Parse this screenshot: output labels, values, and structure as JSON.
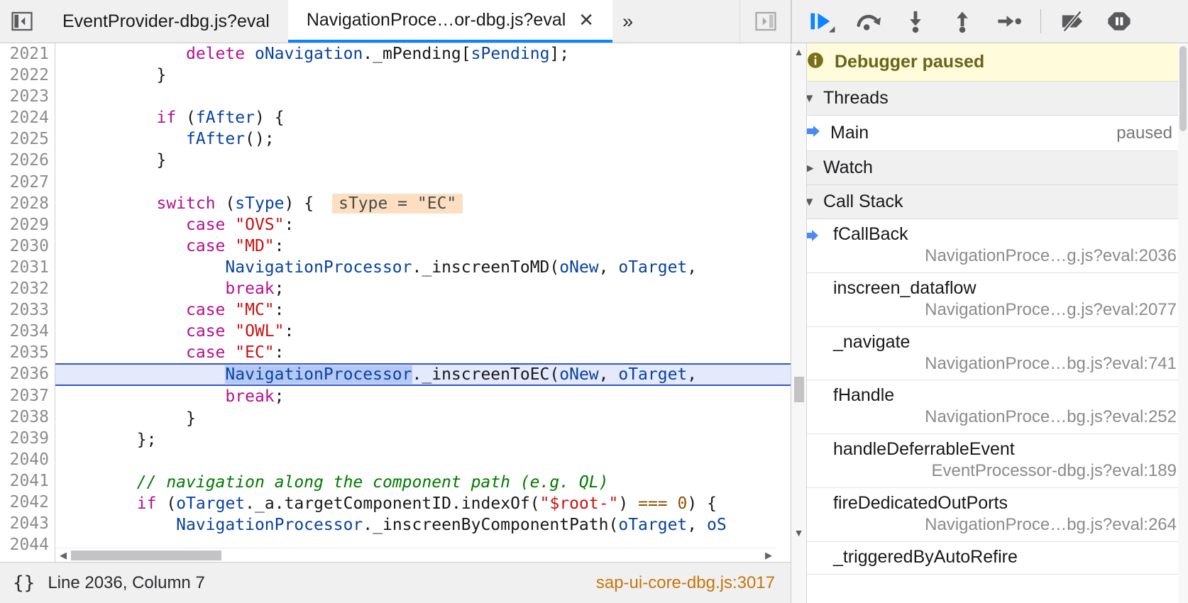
{
  "tabbar": {
    "prev_button_icon": "panel-collapse-left-icon",
    "next_button_icon": "panel-expand-right-icon",
    "overflow_label": "»",
    "close_label": "✕",
    "tabs": [
      {
        "label": "EventProvider-dbg.js?eval",
        "active": false
      },
      {
        "label": "NavigationProce…or-dbg.js?eval",
        "active": true
      }
    ]
  },
  "editor": {
    "first_line": 2021,
    "paused_line": 2036,
    "inline_preview": "sType = \"EC\"",
    "lines": [
      {
        "num": "2021",
        "indent": 13,
        "tokens": [
          [
            "kw",
            "delete"
          ],
          [
            "plain",
            " "
          ],
          [
            "var",
            "oNavigation"
          ],
          [
            "punc",
            "."
          ],
          [
            "prop",
            "_mPending"
          ],
          [
            "punc",
            "["
          ],
          [
            "var",
            "sPending"
          ],
          [
            "punc",
            "];"
          ]
        ]
      },
      {
        "num": "2022",
        "indent": 10,
        "tokens": [
          [
            "punc",
            "}"
          ]
        ]
      },
      {
        "num": "2023",
        "indent": 0,
        "tokens": []
      },
      {
        "num": "2024",
        "indent": 10,
        "tokens": [
          [
            "kw",
            "if"
          ],
          [
            "plain",
            " "
          ],
          [
            "punc",
            "("
          ],
          [
            "var",
            "fAfter"
          ],
          [
            "punc",
            ") {"
          ]
        ]
      },
      {
        "num": "2025",
        "indent": 13,
        "tokens": [
          [
            "var",
            "fAfter"
          ],
          [
            "punc",
            "();"
          ]
        ]
      },
      {
        "num": "2026",
        "indent": 10,
        "tokens": [
          [
            "punc",
            "}"
          ]
        ]
      },
      {
        "num": "2027",
        "indent": 0,
        "tokens": []
      },
      {
        "num": "2028",
        "indent": 10,
        "tokens": [
          [
            "kw",
            "switch"
          ],
          [
            "plain",
            " "
          ],
          [
            "punc",
            "("
          ],
          [
            "var",
            "sType"
          ],
          [
            "punc",
            ") {"
          ],
          [
            "preview",
            "sType = \"EC\""
          ]
        ]
      },
      {
        "num": "2029",
        "indent": 13,
        "tokens": [
          [
            "kw",
            "case"
          ],
          [
            "plain",
            " "
          ],
          [
            "str",
            "\"OVS\""
          ],
          [
            "punc",
            ":"
          ]
        ]
      },
      {
        "num": "2030",
        "indent": 13,
        "tokens": [
          [
            "kw",
            "case"
          ],
          [
            "plain",
            " "
          ],
          [
            "str",
            "\"MD\""
          ],
          [
            "punc",
            ":"
          ]
        ]
      },
      {
        "num": "2031",
        "indent": 17,
        "tokens": [
          [
            "var",
            "NavigationProcessor"
          ],
          [
            "punc",
            "."
          ],
          [
            "prop",
            "_inscreenToMD"
          ],
          [
            "punc",
            "("
          ],
          [
            "var",
            "oNew"
          ],
          [
            "punc",
            ", "
          ],
          [
            "var",
            "oTarget"
          ],
          [
            "punc",
            ","
          ]
        ]
      },
      {
        "num": "2032",
        "indent": 17,
        "tokens": [
          [
            "kw",
            "break"
          ],
          [
            "punc",
            ";"
          ]
        ]
      },
      {
        "num": "2033",
        "indent": 13,
        "tokens": [
          [
            "kw",
            "case"
          ],
          [
            "plain",
            " "
          ],
          [
            "str",
            "\"MC\""
          ],
          [
            "punc",
            ":"
          ]
        ]
      },
      {
        "num": "2034",
        "indent": 13,
        "tokens": [
          [
            "kw",
            "case"
          ],
          [
            "plain",
            " "
          ],
          [
            "str",
            "\"OWL\""
          ],
          [
            "punc",
            ":"
          ]
        ]
      },
      {
        "num": "2035",
        "indent": 13,
        "tokens": [
          [
            "kw",
            "case"
          ],
          [
            "plain",
            " "
          ],
          [
            "str",
            "\"EC\""
          ],
          [
            "punc",
            ":"
          ]
        ]
      },
      {
        "num": "2036",
        "indent": 17,
        "paused": true,
        "tokens": [
          [
            "sel",
            "NavigationProcessor"
          ],
          [
            "punc",
            "."
          ],
          [
            "prop",
            "_inscreenToEC"
          ],
          [
            "punc",
            "("
          ],
          [
            "var",
            "oNew"
          ],
          [
            "punc",
            ", "
          ],
          [
            "var",
            "oTarget"
          ],
          [
            "punc",
            ","
          ]
        ]
      },
      {
        "num": "2037",
        "indent": 17,
        "tokens": [
          [
            "kw",
            "break"
          ],
          [
            "punc",
            ";"
          ]
        ]
      },
      {
        "num": "2038",
        "indent": 13,
        "tokens": [
          [
            "punc",
            "}"
          ]
        ]
      },
      {
        "num": "2039",
        "indent": 8,
        "tokens": [
          [
            "punc",
            "};"
          ]
        ]
      },
      {
        "num": "2040",
        "indent": 0,
        "tokens": []
      },
      {
        "num": "2041",
        "indent": 8,
        "tokens": [
          [
            "com",
            "// navigation along the component path (e.g. QL)"
          ]
        ]
      },
      {
        "num": "2042",
        "indent": 8,
        "tokens": [
          [
            "kw",
            "if"
          ],
          [
            "plain",
            " "
          ],
          [
            "punc",
            "("
          ],
          [
            "var",
            "oTarget"
          ],
          [
            "punc",
            "."
          ],
          [
            "prop",
            "_a"
          ],
          [
            "punc",
            "."
          ],
          [
            "prop",
            "targetComponentID"
          ],
          [
            "punc",
            "."
          ],
          [
            "prop",
            "indexOf"
          ],
          [
            "punc",
            "("
          ],
          [
            "str",
            "\"$root-\""
          ],
          [
            "punc",
            ") "
          ],
          [
            "op",
            "==="
          ],
          [
            "plain",
            " "
          ],
          [
            "num",
            "0"
          ],
          [
            "punc",
            ") {"
          ]
        ]
      },
      {
        "num": "2043",
        "indent": 12,
        "tokens": [
          [
            "var",
            "NavigationProcessor"
          ],
          [
            "punc",
            "."
          ],
          [
            "prop",
            "_inscreenByComponentPath"
          ],
          [
            "punc",
            "("
          ],
          [
            "var",
            "oTarget"
          ],
          [
            "punc",
            ", "
          ],
          [
            "var",
            "oS"
          ]
        ]
      },
      {
        "num": "2044",
        "indent": 0,
        "tokens": []
      }
    ]
  },
  "statusbar": {
    "prettyprint_label": "{}",
    "position": "Line 2036, Column 7",
    "source": "sap-ui-core-dbg.js:3017"
  },
  "debugger_toolbar": {
    "buttons": [
      {
        "name": "resume-button",
        "title": "Resume",
        "icon": "play-icon",
        "active": true
      },
      {
        "name": "step-over-button",
        "title": "Step over",
        "icon": "step-over-icon",
        "active": false
      },
      {
        "name": "step-in-button",
        "title": "Step in",
        "icon": "step-in-icon",
        "active": false
      },
      {
        "name": "step-out-button",
        "title": "Step out",
        "icon": "step-out-icon",
        "active": false
      },
      {
        "name": "step-to-next-button",
        "title": "Step to next",
        "icon": "step-next-icon",
        "active": false
      },
      {
        "name": "deactivate-breakpoints-button",
        "title": "Deactivate breakpoints",
        "icon": "breakpoints-off-icon",
        "active": false
      },
      {
        "name": "pause-on-exceptions-button",
        "title": "Pause on exceptions",
        "icon": "pause-octagon-icon",
        "active": false
      }
    ]
  },
  "debugger_pane": {
    "paused_banner": {
      "icon": "info-icon",
      "text": "Debugger paused"
    },
    "threads_section": {
      "label": "Threads",
      "expanded": true
    },
    "threads": [
      {
        "name": "Main",
        "state": "paused",
        "selected": true
      }
    ],
    "watch_section": {
      "label": "Watch",
      "expanded": false
    },
    "callstack_section": {
      "label": "Call Stack",
      "expanded": true
    },
    "callstack": [
      {
        "fn": "fCallBack",
        "loc": "NavigationProce…g.js?eval:2036",
        "current": true
      },
      {
        "fn": "inscreen_dataflow",
        "loc": "NavigationProce…g.js?eval:2077",
        "current": false
      },
      {
        "fn": "_navigate",
        "loc": "NavigationProce…bg.js?eval:741",
        "current": false
      },
      {
        "fn": "fHandle",
        "loc": "NavigationProce…bg.js?eval:252",
        "current": false
      },
      {
        "fn": "handleDeferrableEvent",
        "loc": "EventProcessor-dbg.js?eval:189",
        "current": false
      },
      {
        "fn": "fireDedicatedOutPorts",
        "loc": "NavigationProce…bg.js?eval:264",
        "current": false
      },
      {
        "fn": "_triggeredByAutoRefire",
        "loc": "",
        "current": false
      }
    ]
  },
  "colors": {
    "accent_blue": "#0a84ff",
    "paused_banner_bg": "#fffbdb",
    "paused_banner_fg": "#6b6318",
    "paused_line_bg": "#e4e9fb",
    "inline_preview_bg": "#fbdfc0",
    "source_link": "#c4770a"
  }
}
